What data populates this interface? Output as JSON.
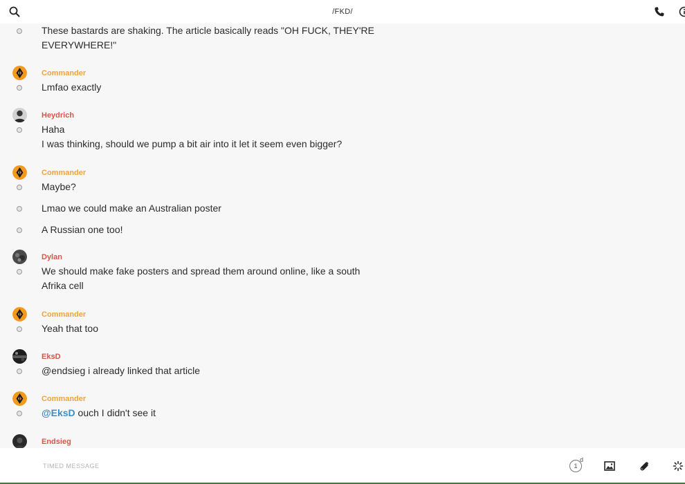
{
  "header": {
    "title": "/FKD/"
  },
  "messages": [
    {
      "sender": "",
      "text": "These bastards are shaking. The article basically reads \"OH FUCK, THEY'RE EVERYWHERE!\""
    },
    {
      "sender": "Commander",
      "text": "Lmfao exactly"
    },
    {
      "sender": "Heydrich",
      "text": "Haha"
    },
    {
      "sender": "",
      "text": "I was thinking, should we pump a bit air into it let it seem even bigger?"
    },
    {
      "sender": "Commander",
      "text": "Maybe?"
    },
    {
      "sender": "",
      "text": "Lmao we could make an Australian poster"
    },
    {
      "sender": "",
      "text": "A Russian one too!"
    },
    {
      "sender": "Dylan",
      "text": "We should make fake posters and spread them around online, like a south Afrika cell"
    },
    {
      "sender": "Commander",
      "text": "Yeah that too"
    },
    {
      "sender": "EksD",
      "text": "@endsieg i already linked that article"
    },
    {
      "sender": "Commander",
      "mention": "@EksD",
      "text": " ouch I didn't see it"
    },
    {
      "sender": "Endsieg",
      "text": ""
    }
  ],
  "composer": {
    "placeholder": "TIMED MESSAGE",
    "timer_value": "1",
    "timer_unit": "d"
  },
  "colors": {
    "commander_name": "#f0a33a",
    "other_name": "#d9544b",
    "mention": "#3a8fc6",
    "commander_avatar": "#f39a1e"
  }
}
